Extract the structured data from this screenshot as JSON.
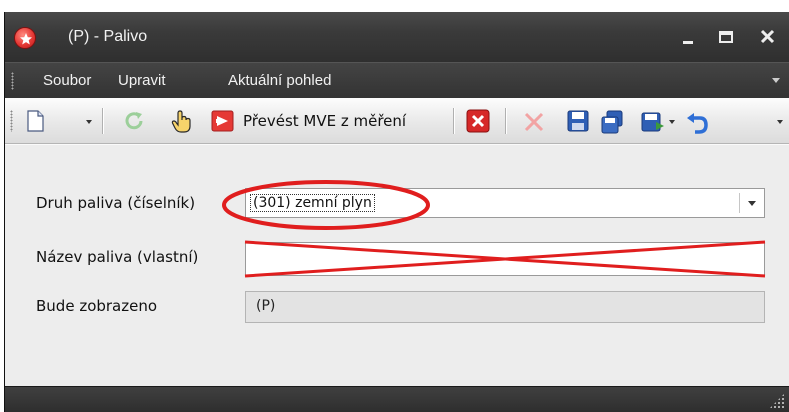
{
  "window": {
    "title": "(P) - Palivo"
  },
  "menu": {
    "items": [
      {
        "label": "Soubor"
      },
      {
        "label": "Upravit"
      },
      {
        "label": "Aktuální pohled"
      }
    ]
  },
  "toolbar": {
    "new_icon": "new-document-icon",
    "refresh_icon": "refresh-icon",
    "hand_icon": "hand-pointer-icon",
    "convert_icon": "convert-icon",
    "convert_label": "Převést MVE z měření",
    "delete_icon": "delete-icon",
    "remove_icon": "remove-icon",
    "save_icon": "save-icon",
    "save_as_icon": "save-as-icon",
    "save_close_icon": "save-close-icon",
    "undo_icon": "undo-icon"
  },
  "form": {
    "fuel_type": {
      "label": "Druh paliva (číselník)",
      "value": "(301) zemní plyn"
    },
    "fuel_name": {
      "label": "Název paliva (vlastní)",
      "value": ""
    },
    "display": {
      "label": "Bude zobrazeno",
      "value": "(P)"
    }
  },
  "colors": {
    "annotation": "#e01e1e",
    "titlebar": "#3a3a3a",
    "form_background": "#ededed",
    "toolbar_accent_red": "#e53935"
  }
}
